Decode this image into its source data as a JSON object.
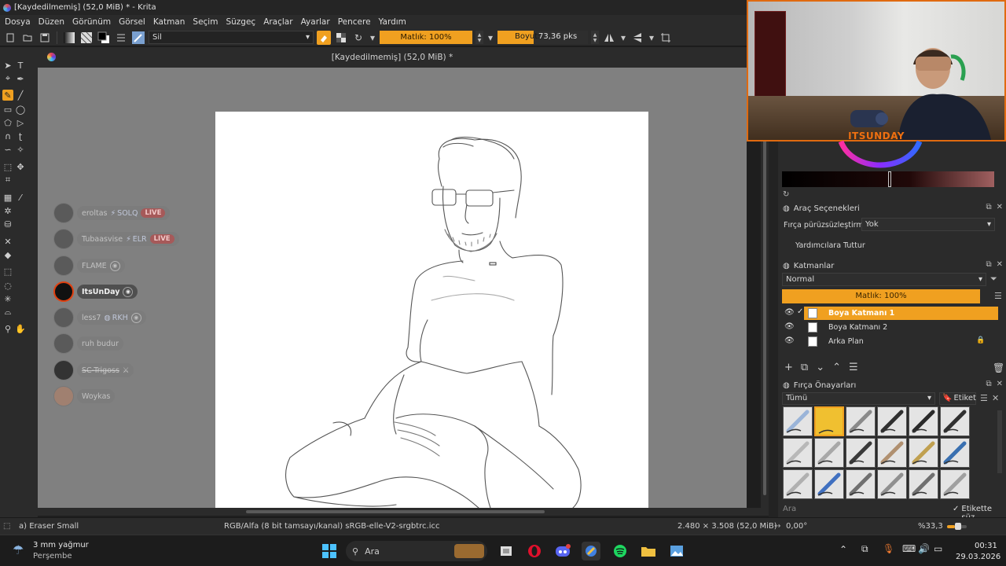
{
  "window": {
    "title": "[Kaydedilmemiş]  (52,0 MiB) * - Krita"
  },
  "menu": [
    "Dosya",
    "Düzen",
    "Görünüm",
    "Görsel",
    "Katman",
    "Seçim",
    "Süzgeç",
    "Araçlar",
    "Ayarlar",
    "Pencere",
    "Yardım"
  ],
  "toolbar": {
    "brush_preset": "Sil",
    "opacity_label": "Matlık: 100%",
    "size_label": "Boyut:",
    "size_value": "73,36 pks"
  },
  "document": {
    "tab_title": "[Kaydedilmemiş]  (52,0 MiB) *"
  },
  "chat": [
    {
      "user": "eroltas",
      "tag": "SOLQ",
      "badge": "LIVE"
    },
    {
      "user": "Tubaasvise",
      "tag": "ELR",
      "badge": "LIVE"
    },
    {
      "user": "FLAME"
    },
    {
      "user": "ItsUnDay"
    },
    {
      "user": "less7",
      "tag": "RKH"
    },
    {
      "user": "ruh budur"
    },
    {
      "user": "SC-Trigoss"
    },
    {
      "user": "Woykas"
    }
  ],
  "webcam": {
    "overlay_name": "ITSUNDAY"
  },
  "tool_options": {
    "title": "Araç Seçenekleri",
    "smoothing_label": "Fırça pürüzsüzleştirme:",
    "smoothing_value": "Yok",
    "snap_label": "Yardımcılara Tuttur"
  },
  "layers": {
    "title": "Katmanlar",
    "blend_mode": "Normal",
    "opacity": "Matlık:  100%",
    "items": [
      {
        "name": "Boya Katmanı 1",
        "selected": true
      },
      {
        "name": "Boya Katmanı 2",
        "selected": false
      },
      {
        "name": "Arka Plan",
        "selected": false
      }
    ]
  },
  "brush_presets": {
    "title": "Fırça Önayarları",
    "filter": "Tümü",
    "tag_button": "Etiket",
    "search_placeholder": "Ara",
    "tag_search_label": "Etikette süz"
  },
  "status": {
    "tool": "a) Eraser Small",
    "color_profile": "RGB/Alfa (8 bit tamsayı/kanal)  sRGB-elle-V2-srgbtrc.icc",
    "dimensions": "2.480 × 3.508 (52,0 MiB)",
    "rotation": "0,00°",
    "zoom": "%33,3"
  },
  "taskbar": {
    "weather_temp": "3 mm yağmur",
    "weather_day": "Perşembe",
    "search_label": "Ara",
    "time": "00:31",
    "date": "29.03.2026"
  },
  "colors": {
    "accent": "#f0a020",
    "panel_bg": "#2b2b2b",
    "canvas_bg": "#808080",
    "stream_orange": "#e06a10"
  }
}
